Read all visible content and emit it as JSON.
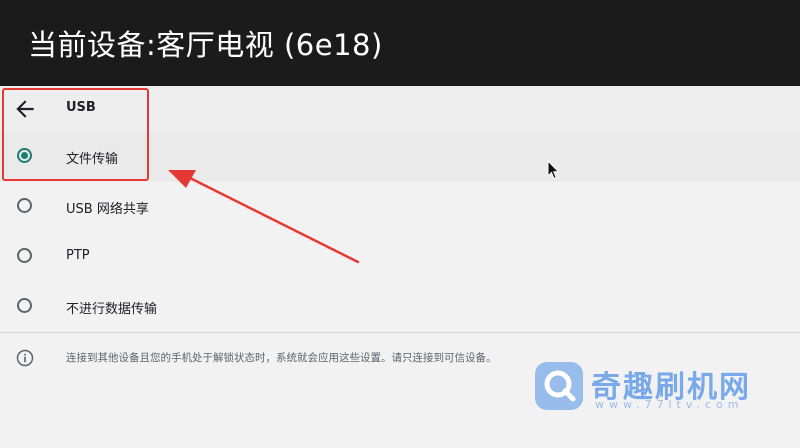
{
  "header": {
    "title": "当前设备:客厅电视 (6e18)"
  },
  "subheader": {
    "title": "USB",
    "back_icon": "arrow-back-icon"
  },
  "options": [
    {
      "label": "文件传输",
      "checked": true
    },
    {
      "label": "USB 网络共享",
      "checked": false
    },
    {
      "label": "PTP",
      "checked": false
    },
    {
      "label": "不进行数据传输",
      "checked": false
    }
  ],
  "info": {
    "icon": "info-icon",
    "text": "连接到其他设备且您的手机处于解锁状态时，系统就会应用这些设置。请只连接到可信设备。"
  },
  "watermark": {
    "name": "奇趣刷机网",
    "url": "www.77itv.com"
  },
  "colors": {
    "header_bg": "#1b1b1b",
    "accent": "#1a7f6e",
    "annotation": "#e53935",
    "watermark": "#7aa9ea"
  }
}
